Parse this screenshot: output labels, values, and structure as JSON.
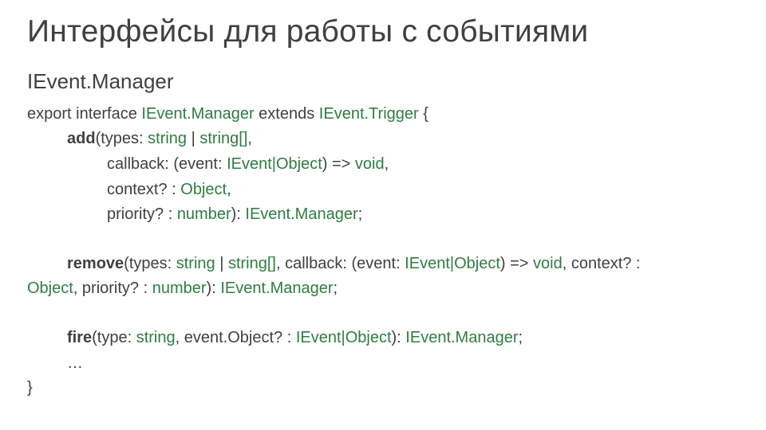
{
  "slide": {
    "title": "Интерфейсы для работы с событиями",
    "subtitle": "IEvent.Manager",
    "code": {
      "decl_export": "export interface ",
      "decl_name": "IEvent.Manager",
      "decl_extends": " extends ",
      "decl_base": "IEvent.Trigger",
      "decl_open": " {",
      "add_name": "add",
      "add_l1_a": "(types: ",
      "t_string": "string",
      "pipe_sp": " | ",
      "t_string_arr": "string[]",
      "comma": ",",
      "add_l2_a": "callback: (event: ",
      "t_ievent_obj": "IEvent|Object",
      "add_l2_b": ") => ",
      "t_void": "void",
      "add_l3_a": "context? : ",
      "t_object": "Object",
      "add_l4_a": "priority? : ",
      "t_number": "number",
      "add_l4_b": "): ",
      "t_mgr": "IEvent.Manager",
      "semi": ";",
      "remove_name": "remove",
      "remove_l1_a": "(types: ",
      "remove_l1_b": ", callback: (event: ",
      "remove_l1_c": ") => ",
      "remove_l1_d": ", context? : ",
      "remove_l2_a": ", priority? : ",
      "remove_l2_b": "): ",
      "fire_name": "fire",
      "fire_a": "(type: ",
      "fire_b": ", event.Object? : ",
      "fire_c": "): ",
      "ellipsis": "…",
      "close": "}"
    }
  }
}
